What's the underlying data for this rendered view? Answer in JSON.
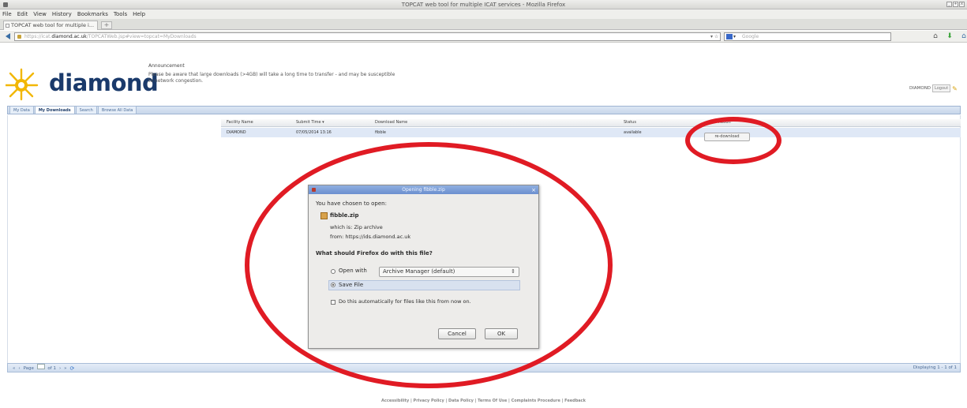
{
  "window": {
    "title": "TOPCAT web tool for multiple ICAT services - Mozilla Firefox",
    "controls": [
      "_",
      "+",
      "x"
    ]
  },
  "menu": [
    "File",
    "Edit",
    "View",
    "History",
    "Bookmarks",
    "Tools",
    "Help"
  ],
  "browser_tab": {
    "label": "TOPCAT web tool for multiple i...",
    "new_tab": "+"
  },
  "navbar": {
    "url_prefix": "https://icat.",
    "url_domain": "diamond.ac.uk",
    "url_suffix": "/TOPCATWeb.jsp#view=topcat=MyDownloads",
    "search_placeholder": "Google",
    "search_arrow": "▾",
    "back_icon": "back-arrow-icon",
    "tools_icon_text": "▾ ☆",
    "icons": [
      "⌂",
      "⬇",
      "⌂"
    ]
  },
  "header": {
    "logo_text": "diamond",
    "announcement_title": "Announcement",
    "announcement_text": "Please be aware that large downloads (>4GB) will take a long time to transfer - and may be susceptible to network congestion.",
    "user": "DIAMOND",
    "logout_label": "Logout"
  },
  "app_tabs": [
    "My Data",
    "My Downloads",
    "Search",
    "Browse All Data"
  ],
  "grid": {
    "columns": [
      "Facility Name",
      "Submit Time ▾",
      "Download Name",
      "Status",
      "Action"
    ],
    "rows": [
      {
        "facility": "DIAMOND",
        "submit_time": "07/05/2014 13:16",
        "download_name": "fibble",
        "status": "available",
        "action": "re-download"
      }
    ]
  },
  "pager": {
    "page_label": "Page",
    "page_value": "1",
    "of_label": "of 1",
    "first_icon": "«",
    "prev_icon": "‹",
    "next_icon": "›",
    "last_icon": "»",
    "refresh_icon": "⟳",
    "display_text": "Displaying 1 - 1 of 1"
  },
  "footer": {
    "links": "Accessibility | Privacy Policy | Data Policy | Terms Of Use | Complaints Procedure | Feedback"
  },
  "dialog": {
    "title": "Opening fibble.zip",
    "close_icon": "×",
    "intro": "You have chosen to open:",
    "filename": "fibble.zip",
    "which_is": "which is:  Zip archive",
    "from": "from:  https://ids.diamond.ac.uk",
    "question": "What should Firefox do with this file?",
    "open_with_label": "Open with",
    "open_with_value": "Archive Manager (default)",
    "open_with_arrow": "⇕",
    "save_file_label": "Save File",
    "auto_label": "Do this automatically for files like this from now on.",
    "cancel": "Cancel",
    "ok": "OK"
  },
  "colors": {
    "annotation": "#e01b24",
    "logo_blue": "#1a3a6b",
    "logo_yellow": "#f2b705"
  }
}
